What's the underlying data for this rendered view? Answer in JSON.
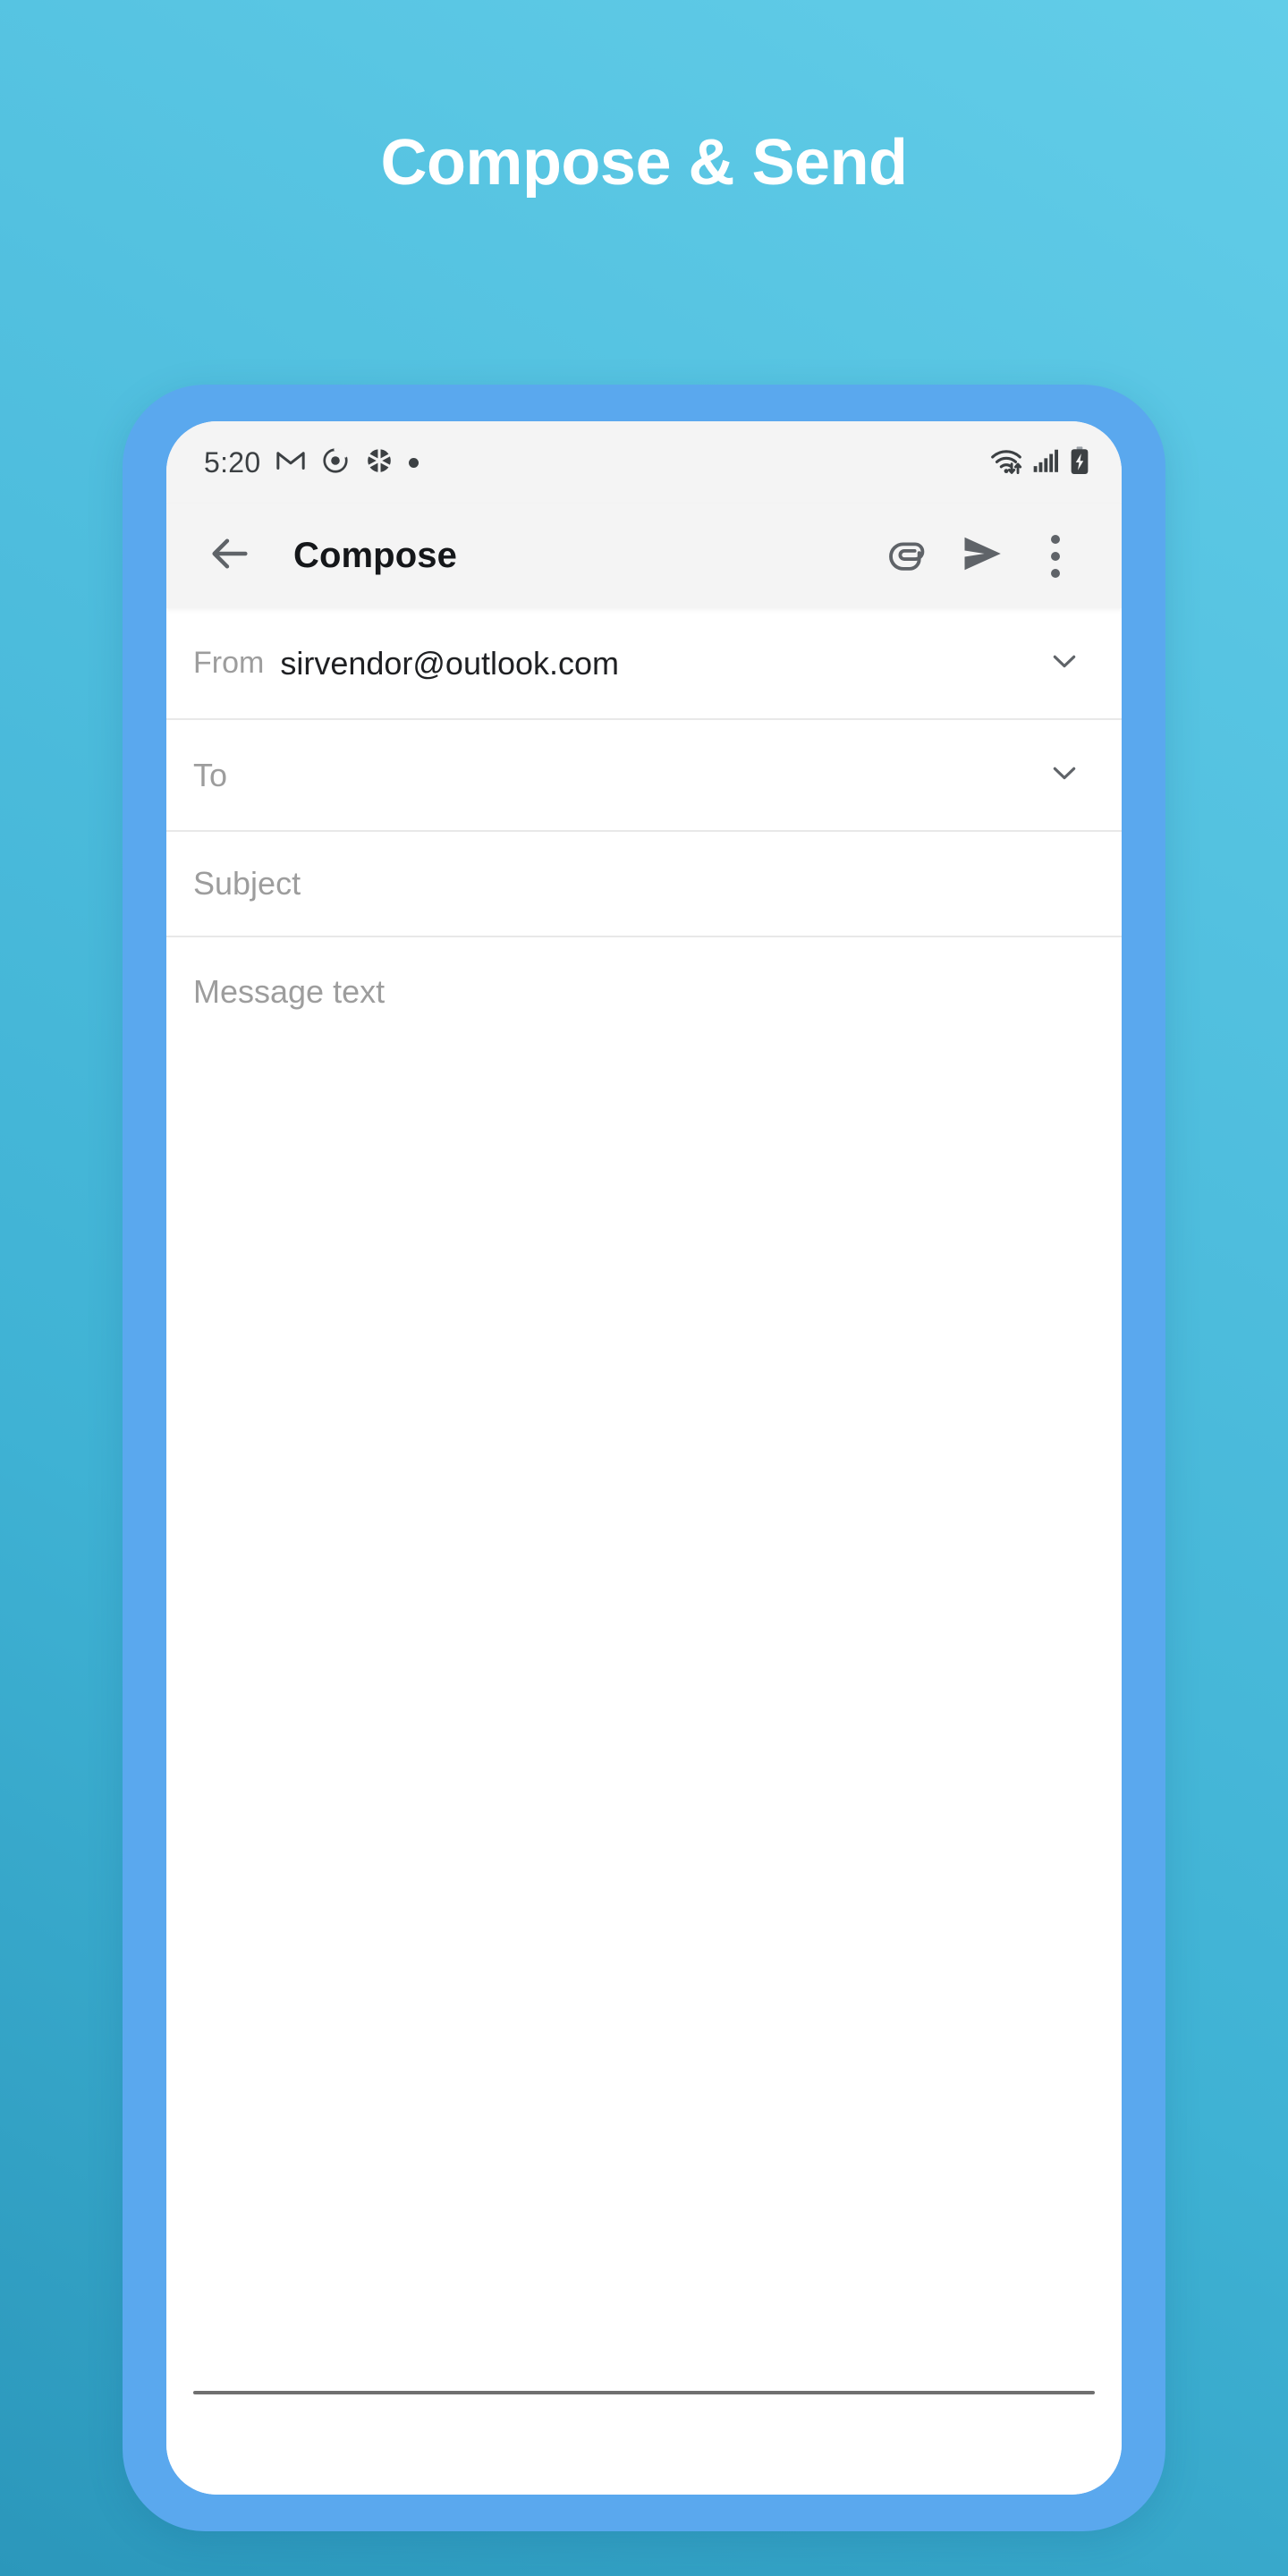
{
  "page": {
    "headline": "Compose & Send",
    "background_top_right": "#62cde8",
    "background_bottom_left": "#2b97bb",
    "phone_frame_color": "#5aa8ee"
  },
  "status_bar": {
    "clock": "5:20",
    "left_icons": [
      "gmail-icon",
      "clock-alarm-icon",
      "camera-aperture-icon",
      "notification-dot-icon"
    ],
    "right_icons": [
      "wifi-data-icon",
      "cellular-signal-icon",
      "battery-charging-icon"
    ]
  },
  "app_bar": {
    "back_icon": "arrow-back-icon",
    "title": "Compose",
    "actions": [
      {
        "name": "attach-button",
        "icon": "paperclip-icon",
        "label": "Attach"
      },
      {
        "name": "send-button",
        "icon": "send-icon",
        "label": "Send"
      },
      {
        "name": "more-options-button",
        "icon": "kebab-menu-icon",
        "label": "More options"
      }
    ]
  },
  "compose": {
    "from": {
      "label": "From",
      "value": "sirvendor@outlook.com",
      "expand_icon": "chevron-down-icon"
    },
    "to": {
      "placeholder": "To",
      "value": "",
      "expand_icon": "chevron-down-icon"
    },
    "subject": {
      "placeholder": "Subject",
      "value": ""
    },
    "message": {
      "placeholder": "Message text",
      "value": ""
    }
  },
  "navigation": {
    "handle": "gesture-nav-handle"
  }
}
